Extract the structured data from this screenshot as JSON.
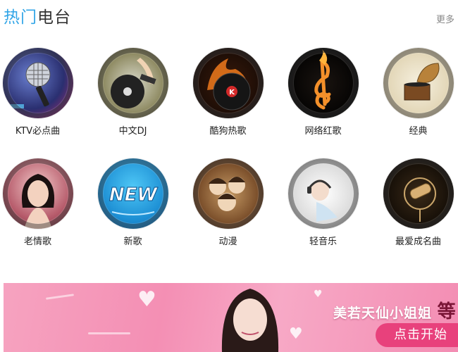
{
  "header": {
    "title_highlight": "热门",
    "title_rest": "电台",
    "more_label": "更多"
  },
  "stations": [
    {
      "label": "KTV必点曲",
      "icon": "microphone-icon"
    },
    {
      "label": "中文DJ",
      "icon": "turntable-icon"
    },
    {
      "label": "酷狗热歌",
      "icon": "flaming-record-icon"
    },
    {
      "label": "网络红歌",
      "icon": "flaming-treble-clef-icon"
    },
    {
      "label": "经典",
      "icon": "gramophone-icon"
    },
    {
      "label": "老情歌",
      "icon": "singer-portrait-icon"
    },
    {
      "label": "新歌",
      "icon": "new-badge-icon"
    },
    {
      "label": "动漫",
      "icon": "anime-characters-icon"
    },
    {
      "label": "轻音乐",
      "icon": "headphones-relax-icon"
    },
    {
      "label": "最爱成名曲",
      "icon": "studio-microphone-icon"
    }
  ],
  "banner": {
    "text": "美若天仙小姐姐",
    "text_big": "等",
    "cta_label": "点击开始"
  },
  "colors": {
    "title_highlight": "#31a5e7",
    "banner_pink": "#f48fb4",
    "cta": "#e8417c"
  }
}
